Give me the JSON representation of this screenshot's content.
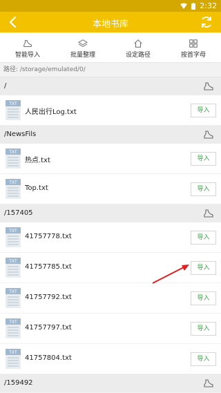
{
  "status": {
    "time": "2:32",
    "wifi_icon": "wifi-icon",
    "battery_icon": "battery-icon"
  },
  "header": {
    "title": "本地书库",
    "back_icon": "chevron-left-icon",
    "refresh_icon": "refresh-icon"
  },
  "toolbar": {
    "items": [
      {
        "label": "智能导入",
        "icon": "shoe-icon"
      },
      {
        "label": "批量整理",
        "icon": "layers-icon"
      },
      {
        "label": "设定路径",
        "icon": "home-icon"
      },
      {
        "label": "按首字母",
        "icon": "grid-icon"
      }
    ]
  },
  "path_text": "路径: /storage/emulated/0/",
  "import_label": "导入",
  "sections": [
    {
      "title": "/",
      "files": [
        "人民出行Log.txt"
      ]
    },
    {
      "title": "/NewsFils",
      "files": [
        "热点.txt",
        "Top.txt"
      ]
    },
    {
      "title": "/157405",
      "files": [
        "41757778.txt",
        "41757785.txt",
        "41757792.txt",
        "41757797.txt",
        "41757804.txt"
      ]
    },
    {
      "title": "/159492",
      "files": []
    }
  ],
  "file_icon_text": "TXT",
  "colors": {
    "accent": "#f2c100",
    "import_text": "#3aa648",
    "arrow": "#e02020"
  }
}
